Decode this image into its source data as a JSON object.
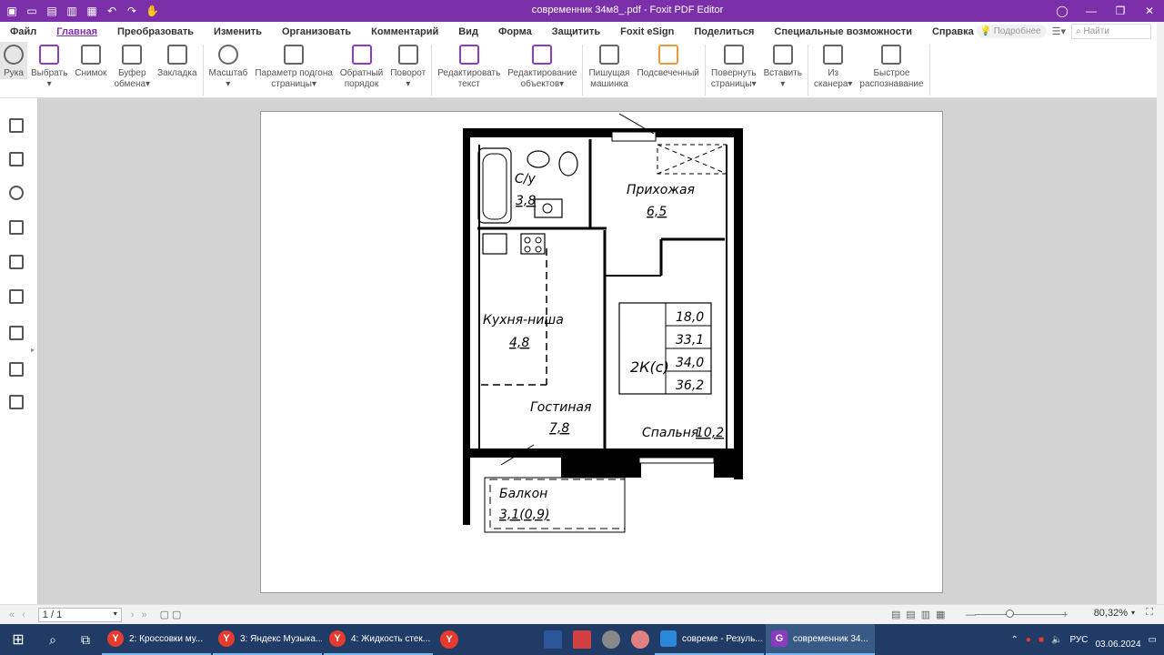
{
  "window": {
    "title": "современник 34м8_.pdf - Foxit PDF Editor"
  },
  "menu": [
    "Файл",
    "Главная",
    "Преобразовать",
    "Изменить",
    "Организовать",
    "Комментарий",
    "Вид",
    "Форма",
    "Защитить",
    "Foxit eSign",
    "Поделиться",
    "Специальные возможности",
    "Справка"
  ],
  "menu_search": {
    "hint": "Подробнее",
    "find_placeholder": "Найти"
  },
  "ribbon": {
    "hand": "Рука",
    "select": "Выбрать",
    "snapshot": "Снимок",
    "clipboard_1": "Буфер",
    "clipboard_2": "обмена",
    "bookmark": "Закладка",
    "zoom": "Масштаб",
    "fit_1": "Параметр подгона",
    "fit_2": "страницы",
    "reverse_1": "Обратный",
    "reverse_2": "порядок",
    "rotate": "Поворот",
    "edit_text_1": "Редактировать",
    "edit_text_2": "текст",
    "edit_obj_1": "Редактирование",
    "edit_obj_2": "объектов",
    "typewriter_1": "Пишущая",
    "typewriter_2": "машинка",
    "highlight": "Подсвеченный",
    "rotate_pages_1": "Повернуть",
    "rotate_pages_2": "страницы",
    "insert": "Вставить",
    "scanner_1": "Из",
    "scanner_2": "сканера",
    "ocr_1": "Быстрое",
    "ocr_2": "распознавание"
  },
  "floorplan": {
    "bath": "С/у",
    "bath_area": "3,8",
    "hall": "Прихожая",
    "hall_area": "6,5",
    "kitchen": "Кухня-ниша",
    "kitchen_area": "4,8",
    "living": "Гостиная",
    "living_area": "7,8",
    "bedroom": "Спальня",
    "bedroom_area": "10,2",
    "balcony": "Балкон",
    "balcony_area": "3,1(0,9)",
    "apt_type": "2К(с)",
    "areas": [
      "18,0",
      "33,1",
      "34,0",
      "36,2"
    ]
  },
  "status": {
    "page": "1 / 1",
    "zoom": "80,32%"
  },
  "taskbar": {
    "apps": [
      "2: Кроссовки му...",
      "3: Яндекс Музыка...",
      "4: Жидкость стек..."
    ],
    "explorer": "совреме - Резуль...",
    "foxit": "современник 34...",
    "lang": "РУС",
    "date": "03.06.2024"
  }
}
